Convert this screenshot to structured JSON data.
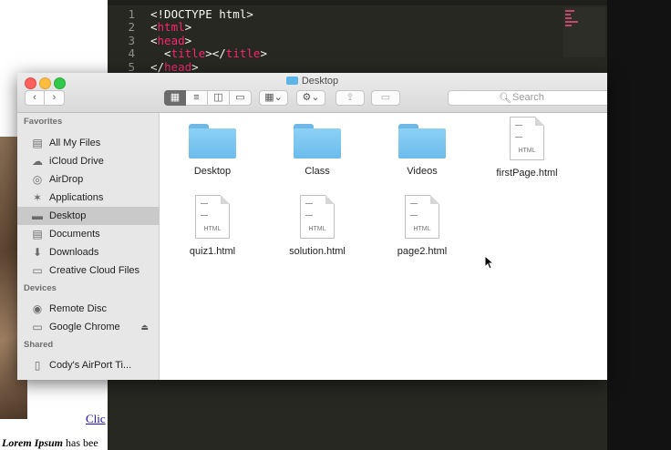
{
  "browser": {
    "link_text": "Clic",
    "body_text_italic": "Lorem Ipsum",
    "body_text": " has bee"
  },
  "editor": {
    "lines": [
      {
        "num": "1",
        "parts": [
          {
            "t": "<!DOCTYPE html>",
            "c": "text"
          }
        ]
      },
      {
        "num": "2",
        "parts": [
          {
            "t": "<",
            "c": "text"
          },
          {
            "t": "html",
            "c": "tag"
          },
          {
            "t": ">",
            "c": "text"
          }
        ]
      },
      {
        "num": "3",
        "parts": [
          {
            "t": "<",
            "c": "text"
          },
          {
            "t": "head",
            "c": "tag"
          },
          {
            "t": ">",
            "c": "text"
          }
        ]
      },
      {
        "num": "4",
        "parts": [
          {
            "t": "  <",
            "c": "text"
          },
          {
            "t": "title",
            "c": "tag"
          },
          {
            "t": "></",
            "c": "text"
          },
          {
            "t": "title",
            "c": "tag"
          },
          {
            "t": ">",
            "c": "text"
          }
        ]
      },
      {
        "num": "5",
        "parts": [
          {
            "t": "</",
            "c": "text"
          },
          {
            "t": "head",
            "c": "tag"
          },
          {
            "t": ">",
            "c": "text"
          }
        ]
      }
    ]
  },
  "finder": {
    "title": "Desktop",
    "toolbar": {
      "back_icon": "chevron-left-icon",
      "forward_icon": "chevron-right-icon",
      "search_placeholder": "Search"
    },
    "sidebar": {
      "sections": [
        {
          "header": "Favorites",
          "items": [
            {
              "label": "All My Files",
              "icon": "all-files-icon",
              "selected": false
            },
            {
              "label": "iCloud Drive",
              "icon": "cloud-icon",
              "selected": false
            },
            {
              "label": "AirDrop",
              "icon": "airdrop-icon",
              "selected": false
            },
            {
              "label": "Applications",
              "icon": "applications-icon",
              "selected": false
            },
            {
              "label": "Desktop",
              "icon": "desktop-icon",
              "selected": true
            },
            {
              "label": "Documents",
              "icon": "documents-icon",
              "selected": false
            },
            {
              "label": "Downloads",
              "icon": "downloads-icon",
              "selected": false
            },
            {
              "label": "Creative Cloud Files",
              "icon": "folder-icon",
              "selected": false
            }
          ]
        },
        {
          "header": "Devices",
          "items": [
            {
              "label": "Remote Disc",
              "icon": "disc-icon",
              "selected": false
            },
            {
              "label": "Google Chrome",
              "icon": "drive-icon",
              "selected": false,
              "eject": true
            }
          ]
        },
        {
          "header": "Shared",
          "items": [
            {
              "label": "Cody's AirPort Ti...",
              "icon": "airport-icon",
              "selected": false
            }
          ]
        }
      ]
    },
    "files": [
      {
        "name": "Desktop",
        "kind": "folder"
      },
      {
        "name": "Class",
        "kind": "folder"
      },
      {
        "name": "Videos",
        "kind": "folder"
      },
      {
        "name": "firstPage.html",
        "kind": "html",
        "type_label": "HTML"
      },
      {
        "name": "quiz1.html",
        "kind": "html",
        "type_label": "HTML"
      },
      {
        "name": "solution.html",
        "kind": "html",
        "type_label": "HTML"
      },
      {
        "name": "page2.html",
        "kind": "html",
        "type_label": "HTML"
      }
    ]
  },
  "colors": {
    "folder_blue": "#6cbcec",
    "editor_bg": "#272822",
    "tag_pink": "#f92672",
    "selection": "#c9c9c9"
  }
}
